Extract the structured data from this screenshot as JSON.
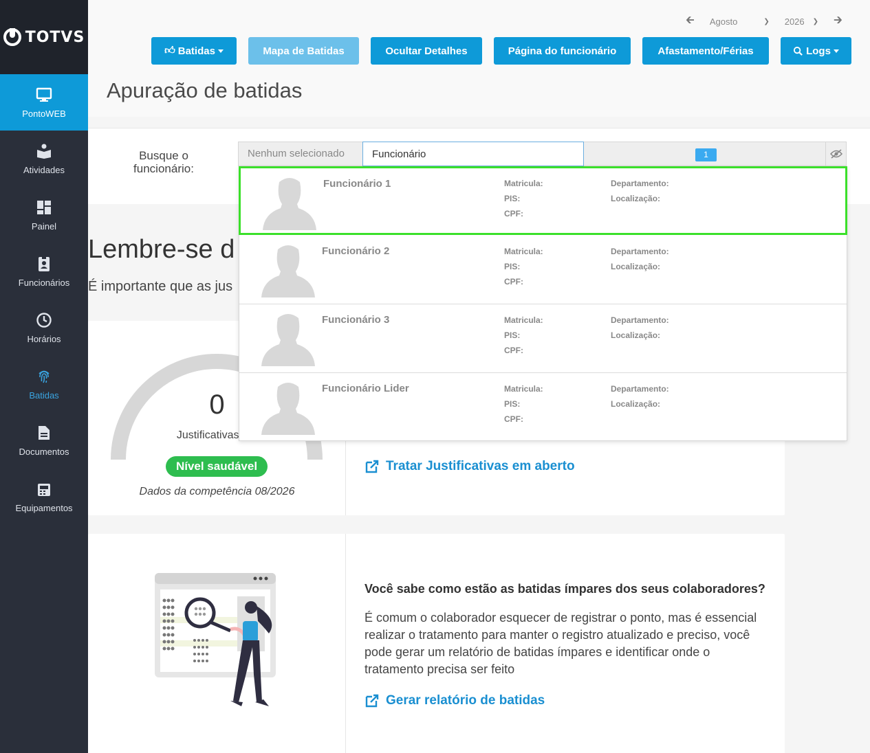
{
  "brand": {
    "name": "TOTVS"
  },
  "sidebar": {
    "items": [
      {
        "label": "PontoWEB",
        "icon": "monitor-icon"
      },
      {
        "label": "Atividades",
        "icon": "activities-icon"
      },
      {
        "label": "Painel",
        "icon": "dashboard-icon"
      },
      {
        "label": "Funcionários",
        "icon": "badge-icon"
      },
      {
        "label": "Horários",
        "icon": "clock-icon"
      },
      {
        "label": "Batidas",
        "icon": "fingerprint-icon"
      },
      {
        "label": "Documentos",
        "icon": "document-icon"
      },
      {
        "label": "Equipamentos",
        "icon": "device-icon"
      }
    ],
    "active": "PontoWEB"
  },
  "header": {
    "month": "Agosto",
    "year": "2026",
    "title": "Apuração de batidas",
    "buttons": {
      "batidas": "Batidas",
      "mapa": "Mapa de Batidas",
      "ocultar": "Ocultar Detalhes",
      "pagina": "Página do funcionário",
      "afastamento": "Afastamento/Férias",
      "logs": "Logs"
    }
  },
  "search": {
    "label": "Busque o funcionário:",
    "none_selected": "Nenhum selecionado",
    "value": "Funcionário",
    "count": "1"
  },
  "reminder": {
    "title": "Lembre-se d",
    "text": "É importante que as jus"
  },
  "justifications": {
    "count": "0",
    "label": "Justificativas em",
    "status": "Nível saudável",
    "competence": "Dados da competência 08/2026",
    "link": "Tratar Justificativas em aberto"
  },
  "odd_punches": {
    "title": "Você sabe como estão as batidas ímpares dos seus colaboradores?",
    "body": "É comum o colaborador esquecer de registrar o ponto, mas é essencial realizar o tratamento para manter o registro atualizado e preciso, você pode gerar um relatório de batidas ímpares e identificar onde o tratamento precisa ser feito",
    "link": "Gerar relatório de batidas"
  },
  "employee_fields": {
    "matricula": "Matricula:",
    "pis": "PIS:",
    "cpf": "CPF:",
    "departamento": "Departamento:",
    "localizacao": "Localização:"
  },
  "employees": [
    {
      "name": "Funcionário 1"
    },
    {
      "name": "Funcionário 2"
    },
    {
      "name": "Funcionário 3"
    },
    {
      "name": "Funcionário Lider"
    }
  ],
  "colors": {
    "primary": "#0e9ad8",
    "sidebar": "#2a2f3a",
    "success": "#2ebd4f",
    "highlight": "#3be02a"
  }
}
